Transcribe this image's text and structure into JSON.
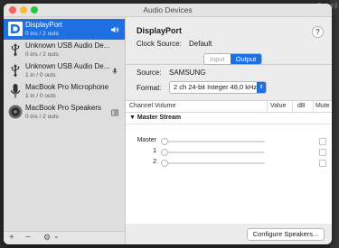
{
  "background": {
    "corner_text": "Downl"
  },
  "window": {
    "title": "Audio Devices"
  },
  "devices": [
    {
      "name": "DisplayPort",
      "io": "0 ins / 2 outs",
      "icon": "displayport-icon",
      "selected": true,
      "right_icon": "speaker-volume-icon"
    },
    {
      "name": "Unknown USB Audio De...",
      "io": "0 ins / 2 outs",
      "icon": "usb-icon",
      "selected": false
    },
    {
      "name": "Unknown USB Audio De...",
      "io": "1 in / 0 outs",
      "icon": "usb-icon",
      "selected": false,
      "right_icon": "microphone-icon"
    },
    {
      "name": "MacBook Pro Microphone",
      "io": "1 in / 0 outs",
      "icon": "microphone-icon",
      "selected": false
    },
    {
      "name": "MacBook Pro Speakers",
      "io": "0 ins / 2 outs",
      "icon": "speaker-icon",
      "selected": false,
      "right_icon": "finder-icon"
    }
  ],
  "sidebar_footer": {
    "add": "+",
    "remove": "−",
    "gear": "⚙",
    "chevron": "⌄"
  },
  "detail": {
    "device_title": "DisplayPort",
    "help": "?",
    "clock_source_label": "Clock Source:",
    "clock_source_value": "Default",
    "tabs": {
      "input": "Input",
      "output": "Output",
      "selected": "Output"
    },
    "source_label": "Source:",
    "source_value": "SAMSUNG",
    "format_label": "Format:",
    "format_value": "2 ch 24-bit Integer 48,0 kHz",
    "table": {
      "headers": {
        "channel": "Channel Volume",
        "value": "Value",
        "db": "dB",
        "mute": "Mute"
      },
      "section": "Master Stream",
      "rows": [
        {
          "label": "Master",
          "level": 0,
          "muted": false
        },
        {
          "label": "1",
          "level": 0,
          "muted": false
        },
        {
          "label": "2",
          "level": 0,
          "muted": false
        }
      ]
    },
    "configure_button": "Configure Speakers..."
  },
  "colors": {
    "accent": "#1e6fe0",
    "close": "#ff5f57",
    "minimize": "#febc2e",
    "zoom": "#28c840"
  }
}
